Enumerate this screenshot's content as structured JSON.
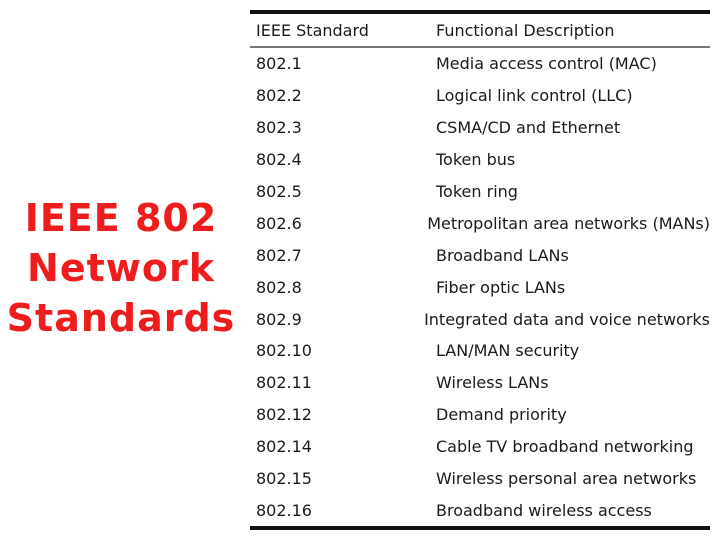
{
  "slide": {
    "title_lines": [
      "IEEE 802",
      "Network",
      "Standards"
    ],
    "title_color": "#ee1c1c"
  },
  "table": {
    "headers": [
      "IEEE Standard",
      "Functional Description"
    ],
    "rows": [
      {
        "standard": "802.1",
        "description": "Media access control (MAC)"
      },
      {
        "standard": "802.2",
        "description": "Logical link control (LLC)"
      },
      {
        "standard": "802.3",
        "description": "CSMA/CD and Ethernet"
      },
      {
        "standard": "802.4",
        "description": "Token bus"
      },
      {
        "standard": "802.5",
        "description": "Token ring"
      },
      {
        "standard": "802.6",
        "description": "Metropolitan area networks (MANs)"
      },
      {
        "standard": "802.7",
        "description": "Broadband LANs"
      },
      {
        "standard": "802.8",
        "description": "Fiber optic LANs"
      },
      {
        "standard": "802.9",
        "description": "Integrated data and voice networks"
      },
      {
        "standard": "802.10",
        "description": "LAN/MAN security"
      },
      {
        "standard": "802.11",
        "description": "Wireless LANs"
      },
      {
        "standard": "802.12",
        "description": "Demand priority"
      },
      {
        "standard": "802.14",
        "description": "Cable TV broadband networking"
      },
      {
        "standard": "802.15",
        "description": "Wireless personal area networks"
      },
      {
        "standard": "802.16",
        "description": "Broadband wireless access"
      }
    ]
  }
}
